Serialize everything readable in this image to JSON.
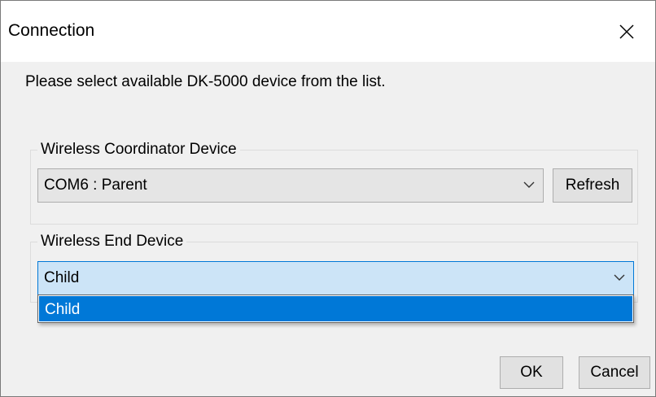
{
  "window": {
    "title": "Connection",
    "close_icon": "close-icon"
  },
  "prompt": "Please select available DK-5000 device from the list.",
  "coordinator_group": {
    "label": "Wireless Coordinator Device",
    "selected": "COM6 : Parent",
    "refresh_label": "Refresh"
  },
  "end_device_group": {
    "label": "Wireless End Device",
    "selected": "Child",
    "options": [
      "Child"
    ],
    "highlighted_option": "Child"
  },
  "buttons": {
    "ok_label": "OK",
    "cancel_label": "Cancel"
  },
  "colors": {
    "accent": "#0078d7",
    "dialog_bg": "#f0f0f0",
    "selection_bg": "#cce4f7"
  }
}
